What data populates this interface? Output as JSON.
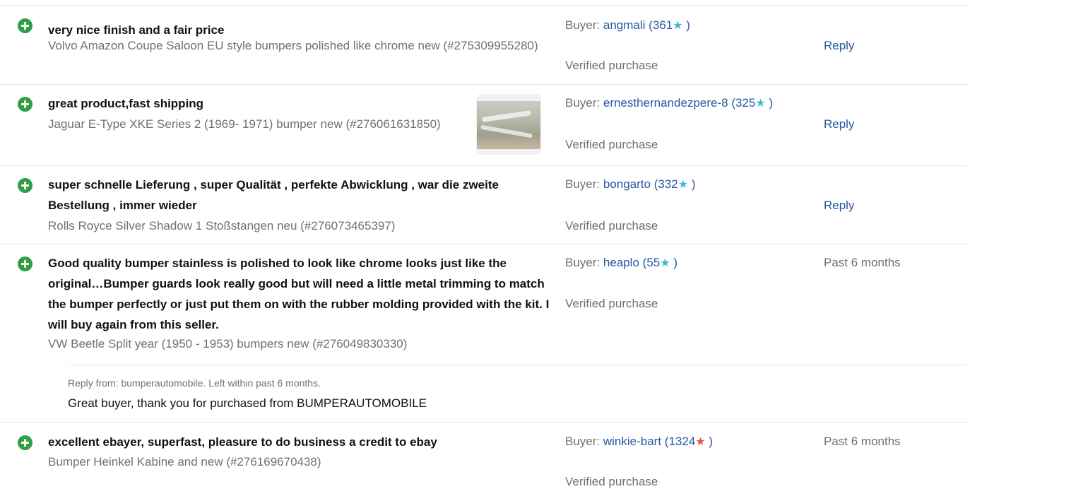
{
  "feedback": [
    {
      "comment": "very nice finish and a fair price",
      "item": "Volvo Amazon Coupe Saloon EU style bumpers polished like chrome new (#275309955280)",
      "buyer_prefix": "Buyer: ",
      "buyer_name": "angmali",
      "score": "361",
      "verified": "Verified purchase",
      "action": "Reply"
    },
    {
      "comment": "great product,fast shipping",
      "item": "Jaguar E-Type XKE Series 2 (1969- 1971) bumper new (#276061631850)",
      "buyer_prefix": "Buyer: ",
      "buyer_name": "ernesthernandezpere-8",
      "score": "325",
      "verified": "Verified purchase",
      "action": "Reply"
    },
    {
      "comment": "super schnelle Lieferung , super Qualität , perfekte Abwicklung , war die zweite Bestellung , immer wieder",
      "item": "Rolls Royce Silver Shadow 1 Stoßstangen neu (#276073465397)",
      "buyer_prefix": "Buyer: ",
      "buyer_name": "bongarto",
      "score": "332",
      "verified": "Verified purchase",
      "action": "Reply"
    },
    {
      "comment": "Good quality bumper stainless is polished to look like chrome looks just like the original…Bumper guards look really good but will need a little metal trimming to match the bumper perfectly or just put them on with the rubber molding provided with the kit. I will buy again from this seller.",
      "item": "VW Beetle Split year (1950 - 1953) bumpers new (#276049830330)",
      "buyer_prefix": "Buyer: ",
      "buyer_name": "heaplo",
      "score": "55",
      "verified": "Verified purchase",
      "time": "Past 6 months",
      "seller_reply_meta": "Reply from: bumperautomobile. Left within past 6 months.",
      "seller_reply_text": "Great buyer, thank you for purchased from BUMPERAUTOMOBILE"
    },
    {
      "comment": "excellent ebayer, superfast, pleasure to do business a credit to ebay",
      "item": "Bumper Heinkel Kabine and new (#276169670438)",
      "buyer_prefix": "Buyer: ",
      "buyer_name": "winkie-bart",
      "score": "1324",
      "verified": "Verified purchase",
      "time": "Past 6 months"
    }
  ],
  "colors": {
    "positive_icon": "#2f9e44",
    "link": "#2856a3",
    "star_teal": "#3db7d6",
    "star_red": "#e0533d"
  },
  "icons": {
    "positive": "plus-circle-icon",
    "star": "star-icon"
  }
}
